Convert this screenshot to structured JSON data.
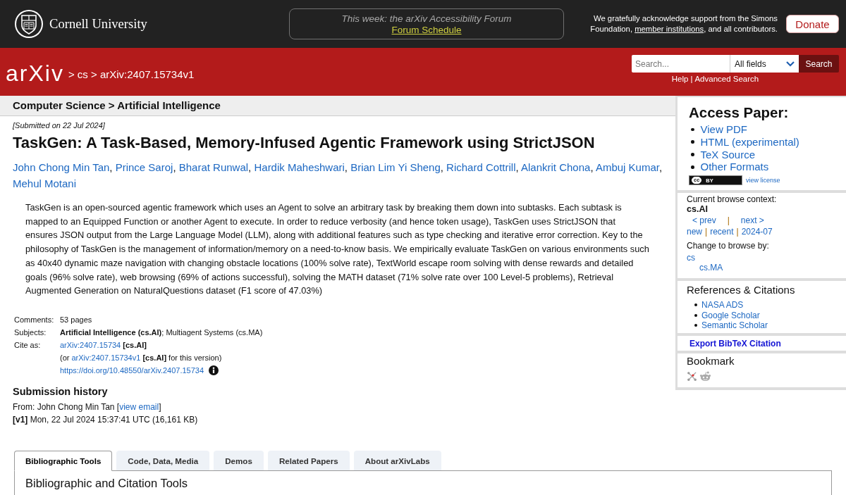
{
  "top_bar": {
    "institution": "Cornell University",
    "announcement": {
      "text": "This week: the arXiv Accessibility Forum",
      "link": "Forum Schedule"
    },
    "acknowledgment": {
      "before": "We gratefully acknowledge support from the Simons Foundation, ",
      "link": "member institutions",
      "after": ", and all contributors."
    },
    "donate_button": "Donate"
  },
  "header": {
    "logo": "arXiv",
    "breadcrumb": "> cs > arXiv:2407.15734v1",
    "search": {
      "placeholder": "Search...",
      "field": "All fields",
      "button": "Search"
    },
    "links": [
      "Help",
      "Advanced Search"
    ],
    "separator": "|"
  },
  "paper": {
    "subject_header": "Computer Science > Artificial Intelligence",
    "submitted": "[Submitted on 22 Jul 2024]",
    "title": "TaskGen: A Task-Based, Memory-Infused Agentic Framework using StrictJSON",
    "authors": [
      "John Chong Min Tan",
      "Prince Saroj",
      "Bharat Runwal",
      "Hardik Maheshwari",
      "Brian Lim Yi Sheng",
      "Richard Cottrill",
      "Alankrit Chona",
      "Ambuj Kumar",
      "Mehul Motani"
    ],
    "author_separator": ",",
    "abstract": "TaskGen is an open-sourced agentic framework which uses an Agent to solve an arbitrary task by breaking them down into subtasks. Each subtask is mapped to an Equipped Function or another Agent to execute. In order to reduce verbosity (and hence token usage), TaskGen uses StrictJSON that ensures JSON output from the Large Language Model (LLM), along with additional features such as type checking and iterative error correction. Key to the philosophy of TaskGen is the management of information/memory on a need-to-know basis. We empirically evaluate TaskGen on various environments such as 40x40 dynamic maze navigation with changing obstacle locations (100% solve rate), TextWorld escape room solving with dense rewards and detailed goals (96% solve rate), web browsing (69% of actions successful), solving the MATH dataset (71% solve rate over 100 Level-5 problems), Retrieval Augmented Generation on NaturalQuestions dataset (F1 score of 47.03%)",
    "metadata": [
      {
        "label": "Comments:",
        "lines": [
          [
            {
              "kind": "text",
              "text": "53 pages"
            }
          ]
        ]
      },
      {
        "label": "Subjects:",
        "lines": [
          [
            {
              "kind": "text",
              "text": "**Artificial Intelligence (cs.AI)**; Multiagent Systems (cs.MA)"
            }
          ]
        ]
      },
      {
        "label": "Cite as:",
        "lines": [
          [
            {
              "kind": "link",
              "text": "arXiv:2407.15734"
            },
            {
              "kind": "text",
              "text": " **[cs.AI]**"
            }
          ],
          [
            {
              "kind": "text",
              "text": "(or "
            },
            {
              "kind": "link",
              "text": "arXiv:2407.15734v1"
            },
            {
              "kind": "text",
              "text": " **[cs.AI]** for this version)"
            }
          ],
          [
            {
              "kind": "link",
              "text": "https://doi.org/10.48550/arXiv.2407.15734"
            },
            {
              "kind": "info"
            }
          ]
        ]
      }
    ],
    "submission_history": {
      "title": "Submission history",
      "from": {
        "before": "From: John Chong Min Tan [",
        "link": "view email",
        "after": "]"
      },
      "versions": [
        "**[v1]** Mon, 22 Jul 2024 15:37:41 UTC (16,161 KB)"
      ]
    }
  },
  "tools": {
    "tabs": [
      {
        "label": "Bibliographic Tools",
        "selected": true
      },
      {
        "label": "Code, Data, Media",
        "selected": false
      },
      {
        "label": "Demos",
        "selected": false
      },
      {
        "label": "Related Papers",
        "selected": false
      },
      {
        "label": "About arXivLabs",
        "selected": false
      }
    ],
    "panel_title": "Bibliographic and Citation Tools"
  },
  "sidebar": {
    "access_paper": {
      "title": "Access Paper:",
      "links": [
        "View PDF",
        "HTML (experimental)",
        "TeX Source",
        "Other Formats"
      ],
      "license_badge": {
        "mark": "cc",
        "type": "BY"
      },
      "license_link": "view license"
    },
    "browse_context": {
      "label": "Current browse context:",
      "category": "cs.AI",
      "prev": "< prev",
      "next": "next >",
      "separator": "|",
      "links": [
        "new",
        "recent",
        "2024-07"
      ],
      "change_label": "Change to browse by:",
      "categories": [
        {
          "label": "cs",
          "children": [
            {
              "label": "cs.MA"
            }
          ]
        }
      ]
    },
    "references": {
      "title": "References & Citations",
      "links": [
        "NASA ADS",
        "Google Scholar",
        "Semantic Scholar"
      ]
    },
    "export_link": "Export BibTeX Citation",
    "bookmark": {
      "title": "Bookmark"
    }
  }
}
